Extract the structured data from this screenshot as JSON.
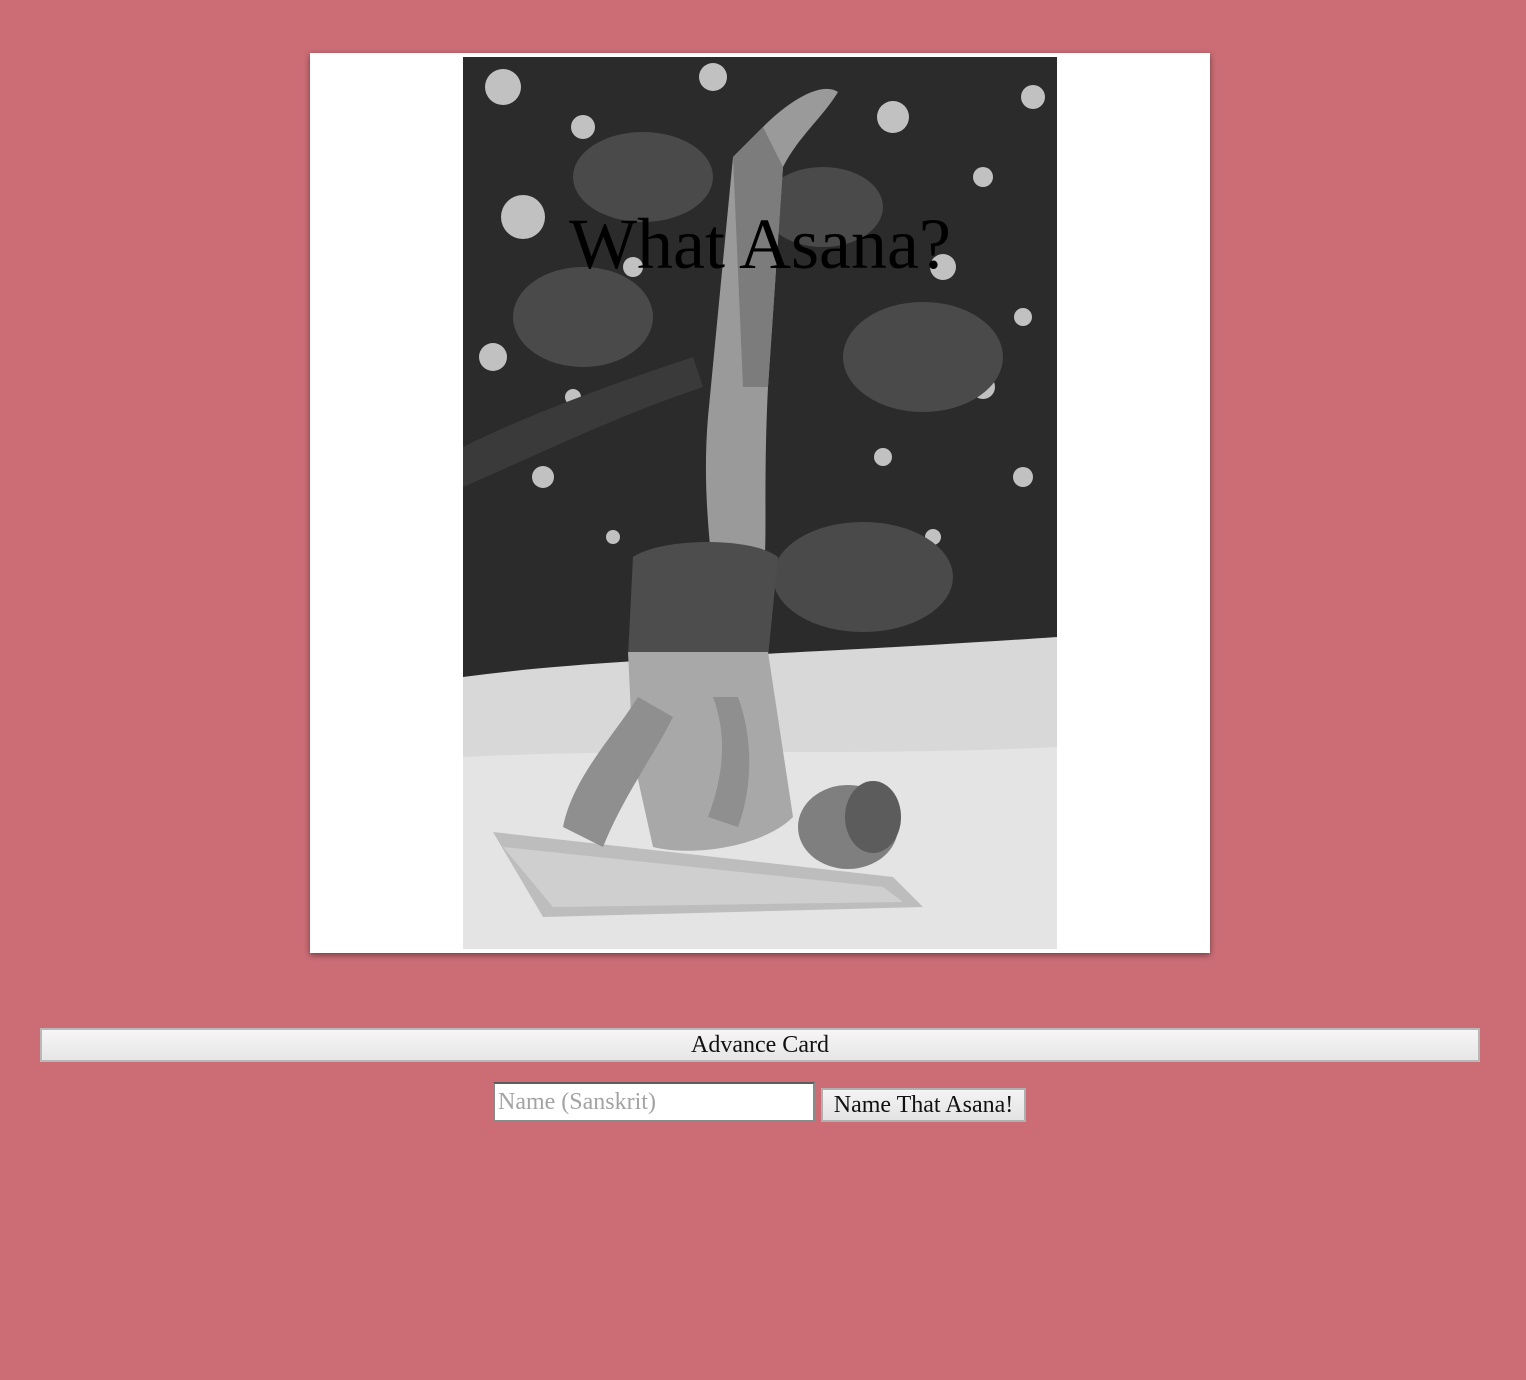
{
  "colors": {
    "page_background": "#cc6d76",
    "card_background": "#ffffff"
  },
  "card": {
    "title": "What Asana?",
    "image_icon": "black-and-white-yoga-photo"
  },
  "controls": {
    "advance_label": "Advance Card",
    "name_input_placeholder": "Name (Sanskrit)",
    "name_input_value": "",
    "submit_label": "Name That Asana!"
  }
}
